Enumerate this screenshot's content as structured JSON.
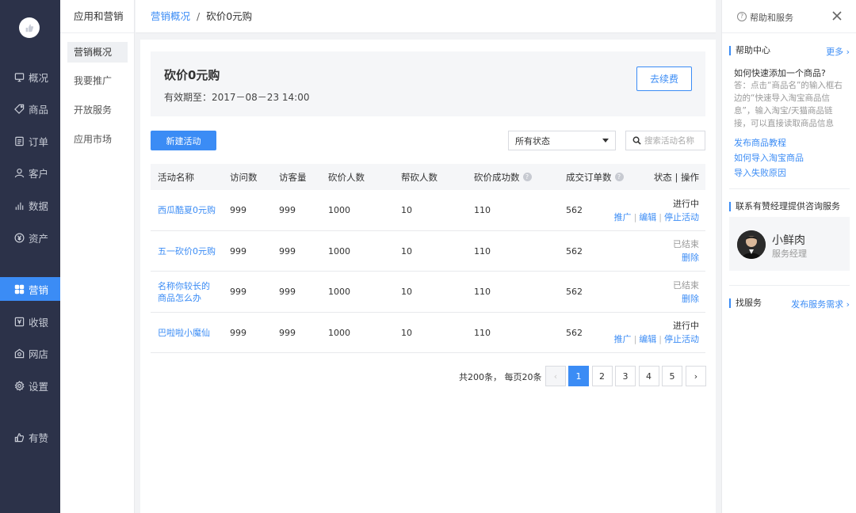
{
  "nav": {
    "items": [
      {
        "label": "概况",
        "icon": "monitor-icon"
      },
      {
        "label": "商品",
        "icon": "tag-icon"
      },
      {
        "label": "订单",
        "icon": "list-icon"
      },
      {
        "label": "客户",
        "icon": "user-icon"
      },
      {
        "label": "数据",
        "icon": "bar-chart-icon"
      },
      {
        "label": "资产",
        "icon": "yen-circle-icon"
      },
      {
        "label": "营销",
        "icon": "grid-icon"
      },
      {
        "label": "收银",
        "icon": "cashier-icon"
      },
      {
        "label": "网店",
        "icon": "store-icon"
      },
      {
        "label": "设置",
        "icon": "gear-icon"
      },
      {
        "label": "有赞",
        "icon": "thumb-icon"
      }
    ],
    "active": "营销"
  },
  "subnav": {
    "title": "应用和营销",
    "items": [
      "营销概况",
      "我要推广",
      "开放服务",
      "应用市场"
    ],
    "active": "营销概况"
  },
  "breadcrumb": {
    "parent": "营销概况",
    "sep": "/",
    "current": "砍价0元购"
  },
  "banner": {
    "title": "砍价0元购",
    "validity": "有效期至：2017－08－23 14:00",
    "renew_label": "去续费"
  },
  "toolbar": {
    "new_label": "新建活动",
    "status_value": "所有状态",
    "search_placeholder": "搜索活动名称"
  },
  "table": {
    "headers": [
      "活动名称",
      "访问数",
      "访客量",
      "砍价人数",
      "帮砍人数",
      "砍价成功数",
      "成交订单数",
      "状态 | 操作"
    ],
    "rows": [
      {
        "name": "西瓜酷夏0元购",
        "visits": "999",
        "visitors": "999",
        "bargainers": "1000",
        "helpers": "10",
        "success": "110",
        "orders": "562",
        "status": "进行中",
        "ended": false,
        "ops": [
          "推广",
          "编辑",
          "停止活动"
        ]
      },
      {
        "name": "五一砍价0元购",
        "visits": "999",
        "visitors": "999",
        "bargainers": "1000",
        "helpers": "10",
        "success": "110",
        "orders": "562",
        "status": "已结束",
        "ended": true,
        "ops": [
          "删除"
        ]
      },
      {
        "name": "名称你较长的\n商品怎么办",
        "visits": "999",
        "visitors": "999",
        "bargainers": "1000",
        "helpers": "10",
        "success": "110",
        "orders": "562",
        "status": "已结束",
        "ended": true,
        "ops": [
          "删除"
        ]
      },
      {
        "name": "巴啦啦小魔仙",
        "visits": "999",
        "visitors": "999",
        "bargainers": "1000",
        "helpers": "10",
        "success": "110",
        "orders": "562",
        "status": "进行中",
        "ended": false,
        "ops": [
          "推广",
          "编辑",
          "停止活动"
        ]
      }
    ]
  },
  "pagination": {
    "info": "共200条，  每页20条",
    "prev": "‹",
    "next": "›",
    "pages": [
      "1",
      "2",
      "3",
      "4",
      "5"
    ],
    "current": "1"
  },
  "help": {
    "title": "帮助和服务",
    "center_title": "帮助中心",
    "more_label": "更多 ›",
    "question": "如何快速添加一个商品?",
    "answer": "答：点击“商品名”的输入框右边的“快速导入淘宝商品信息”，输入淘宝/天猫商品链接，可以直接读取商品信息",
    "links": [
      "发布商品教程",
      "如何导入淘宝商品",
      "导入失败原因"
    ],
    "consult_title": "联系有赞经理提供咨询服务",
    "manager_name": "小鲜肉",
    "manager_role": "服务经理",
    "service_title": "找服务",
    "service_link": "发布服务需求 ›"
  },
  "colors": {
    "nav_bg": "#2c3249",
    "accent": "#3b8cf5"
  }
}
